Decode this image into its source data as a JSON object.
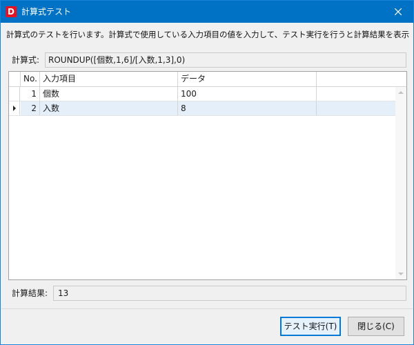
{
  "window": {
    "title": "計算式テスト",
    "app_icon_letter": "D"
  },
  "description": "計算式のテストを行います。計算式で使用している入力項目の値を入力して、テスト実行を行うと計算結果を表示します。",
  "formula": {
    "label": "計算式:",
    "value": "ROUNDUP([個数,1,6]/[入数,1,3],0)"
  },
  "grid": {
    "columns": [
      "No.",
      "入力項目",
      "データ"
    ],
    "rows": [
      {
        "no": "1",
        "item": "個数",
        "data": "100"
      },
      {
        "no": "2",
        "item": "入数",
        "data": "8"
      }
    ]
  },
  "result": {
    "label": "計算結果:",
    "value": "13"
  },
  "buttons": {
    "run_label": "テスト実行(T)",
    "close_label": "閉じる(C)"
  },
  "colors": {
    "titlebar": "#0072c6",
    "selected_row": "#e4eff9",
    "primary_border": "#0078d7"
  }
}
